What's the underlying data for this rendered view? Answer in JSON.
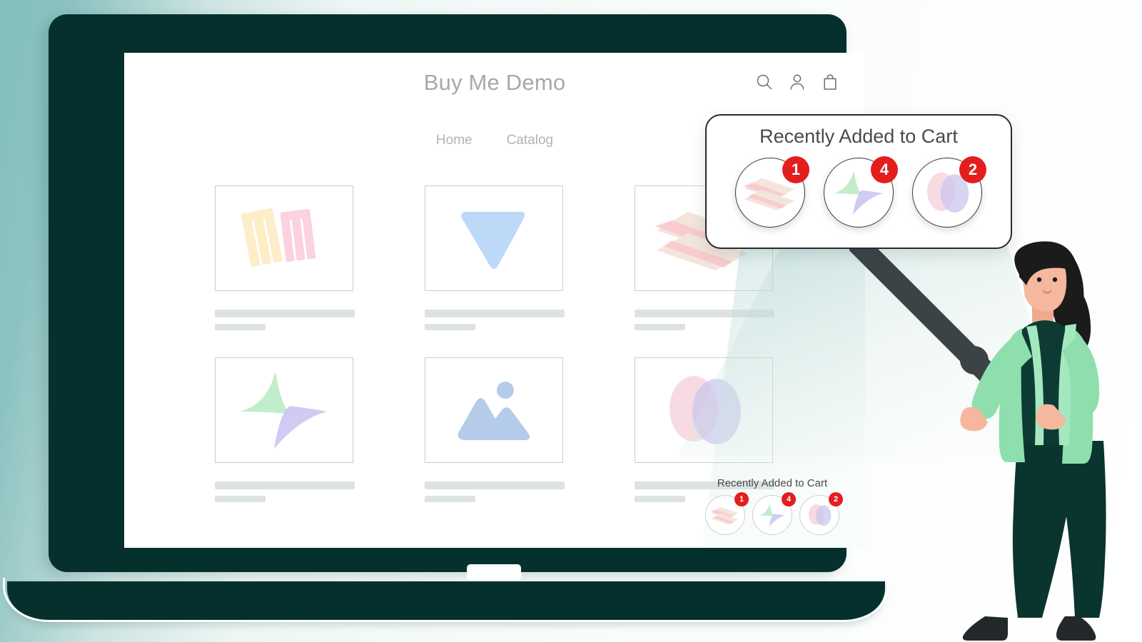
{
  "store": {
    "title": "Buy Me Demo",
    "nav": [
      {
        "label": "Home"
      },
      {
        "label": "Catalog"
      }
    ],
    "header_icons": [
      {
        "name": "search-icon"
      },
      {
        "name": "user-icon"
      },
      {
        "name": "shopping-bag-icon"
      }
    ],
    "products": [
      {
        "art": "ribbons-yellow-pink"
      },
      {
        "art": "triangle-blue"
      },
      {
        "art": "stacked-planes-pink"
      },
      {
        "art": "star-green-purple"
      },
      {
        "art": "image-placeholder"
      },
      {
        "art": "ellipses-pink-purple"
      }
    ]
  },
  "cart_widget": {
    "title": "Recently Added to Cart",
    "items": [
      {
        "art": "stacked-planes-pink",
        "badge": "1"
      },
      {
        "art": "star-green-purple",
        "badge": "4"
      },
      {
        "art": "ellipses-pink-purple",
        "badge": "2"
      }
    ]
  },
  "callout": {
    "title": "Recently Added to Cart",
    "items": [
      {
        "art": "stacked-planes-pink",
        "badge": "1"
      },
      {
        "art": "star-green-purple",
        "badge": "4"
      },
      {
        "art": "ellipses-pink-purple",
        "badge": "2"
      }
    ]
  },
  "colors": {
    "badge_red": "#e41d1d",
    "bezel_dark_teal": "#05302e",
    "background_teal": "#83bfbd",
    "blazer_mint": "#8fdfae",
    "skeleton_gray": "#dde3e2",
    "title_gray": "#a8a8a8"
  },
  "illustration": {
    "figure": "woman-holding-magnifying-glass",
    "device": "laptop"
  }
}
